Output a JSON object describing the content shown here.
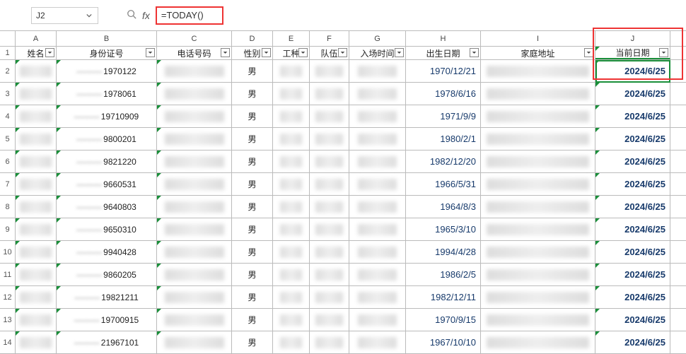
{
  "namebox": "J2",
  "formula": "=TODAY()",
  "columns": {
    "letters": [
      "A",
      "B",
      "C",
      "D",
      "E",
      "F",
      "G",
      "H",
      "I",
      "J"
    ],
    "headers": [
      "姓名",
      "身份证号",
      "电话号码",
      "性别",
      "工种",
      "队伍",
      "入场时间",
      "出生日期",
      "家庭地址",
      "当前日期"
    ]
  },
  "rows": [
    {
      "n": "2",
      "id": "1970122",
      "gender": "男",
      "birth": "1970/12/21",
      "today": "2024/6/25"
    },
    {
      "n": "3",
      "id": "1978061",
      "gender": "男",
      "birth": "1978/6/16",
      "today": "2024/6/25"
    },
    {
      "n": "4",
      "id": "19710909",
      "gender": "男",
      "birth": "1971/9/9",
      "today": "2024/6/25"
    },
    {
      "n": "5",
      "id": "9800201",
      "gender": "男",
      "birth": "1980/2/1",
      "today": "2024/6/25"
    },
    {
      "n": "6",
      "id": "9821220",
      "gender": "男",
      "birth": "1982/12/20",
      "today": "2024/6/25"
    },
    {
      "n": "7",
      "id": "9660531",
      "gender": "男",
      "birth": "1966/5/31",
      "today": "2024/6/25"
    },
    {
      "n": "8",
      "id": "9640803",
      "gender": "男",
      "birth": "1964/8/3",
      "today": "2024/6/25"
    },
    {
      "n": "9",
      "id": "9650310",
      "gender": "男",
      "birth": "1965/3/10",
      "today": "2024/6/25"
    },
    {
      "n": "10",
      "id": "9940428",
      "gender": "男",
      "birth": "1994/4/28",
      "today": "2024/6/25"
    },
    {
      "n": "11",
      "id": "9860205",
      "gender": "男",
      "birth": "1986/2/5",
      "today": "2024/6/25"
    },
    {
      "n": "12",
      "id": "19821211",
      "gender": "男",
      "birth": "1982/12/11",
      "today": "2024/6/25"
    },
    {
      "n": "13",
      "id": "19700915",
      "gender": "男",
      "birth": "1970/9/15",
      "today": "2024/6/25"
    },
    {
      "n": "14",
      "id": "21967101",
      "gender": "男",
      "birth": "1967/10/10",
      "today": "2024/6/25"
    }
  ]
}
